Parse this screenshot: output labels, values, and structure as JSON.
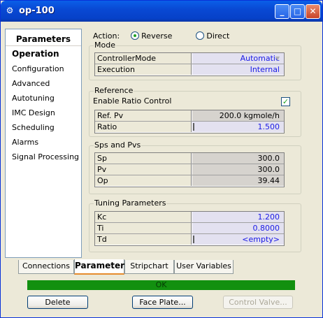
{
  "window": {
    "title": "op-100",
    "icon": "gear-icon",
    "controls": {
      "minimize": "_",
      "maximize": "□",
      "close": "✕"
    }
  },
  "nav": {
    "header": "Parameters",
    "items": [
      {
        "label": "Operation",
        "active": true
      },
      {
        "label": "Configuration"
      },
      {
        "label": "Advanced"
      },
      {
        "label": "Autotuning"
      },
      {
        "label": "IMC Design"
      },
      {
        "label": "Scheduling"
      },
      {
        "label": "Alarms"
      },
      {
        "label": "Signal Processing"
      }
    ]
  },
  "action": {
    "label": "Action:",
    "options": [
      {
        "label": "Reverse",
        "checked": true
      },
      {
        "label": "Direct",
        "checked": false
      }
    ]
  },
  "mode": {
    "title": "Mode",
    "rows": [
      {
        "name": "ControllerMode",
        "value": "Automatic"
      },
      {
        "name": "Execution",
        "value": "Internal"
      }
    ]
  },
  "reference": {
    "title": "Reference",
    "enable_label": "Enable Ratio Control",
    "enable_checked": true,
    "rows": [
      {
        "name": "Ref. Pv",
        "value": "200.0 kgmole/h"
      },
      {
        "name": "Ratio",
        "value": "1.500"
      }
    ]
  },
  "sps": {
    "title": "Sps and Pvs",
    "rows": [
      {
        "name": "Sp",
        "value": "300.0"
      },
      {
        "name": "Pv",
        "value": "300.0"
      },
      {
        "name": "Op",
        "value": "39.44"
      }
    ]
  },
  "tuning": {
    "title": "Tuning Parameters",
    "rows": [
      {
        "name": "Kc",
        "value": "1.200"
      },
      {
        "name": "Ti",
        "value": "0.8000"
      },
      {
        "name": "Td",
        "value": "<empty>"
      }
    ]
  },
  "tabs": [
    {
      "label": "Connections"
    },
    {
      "label": "Parameters",
      "active": true
    },
    {
      "label": "Stripchart"
    },
    {
      "label": "User Variables"
    }
  ],
  "status": {
    "text": "OK",
    "color": "#12900f"
  },
  "buttons": {
    "delete": "Delete",
    "face_plate": "Face Plate...",
    "control_valve": "Control Valve..."
  }
}
